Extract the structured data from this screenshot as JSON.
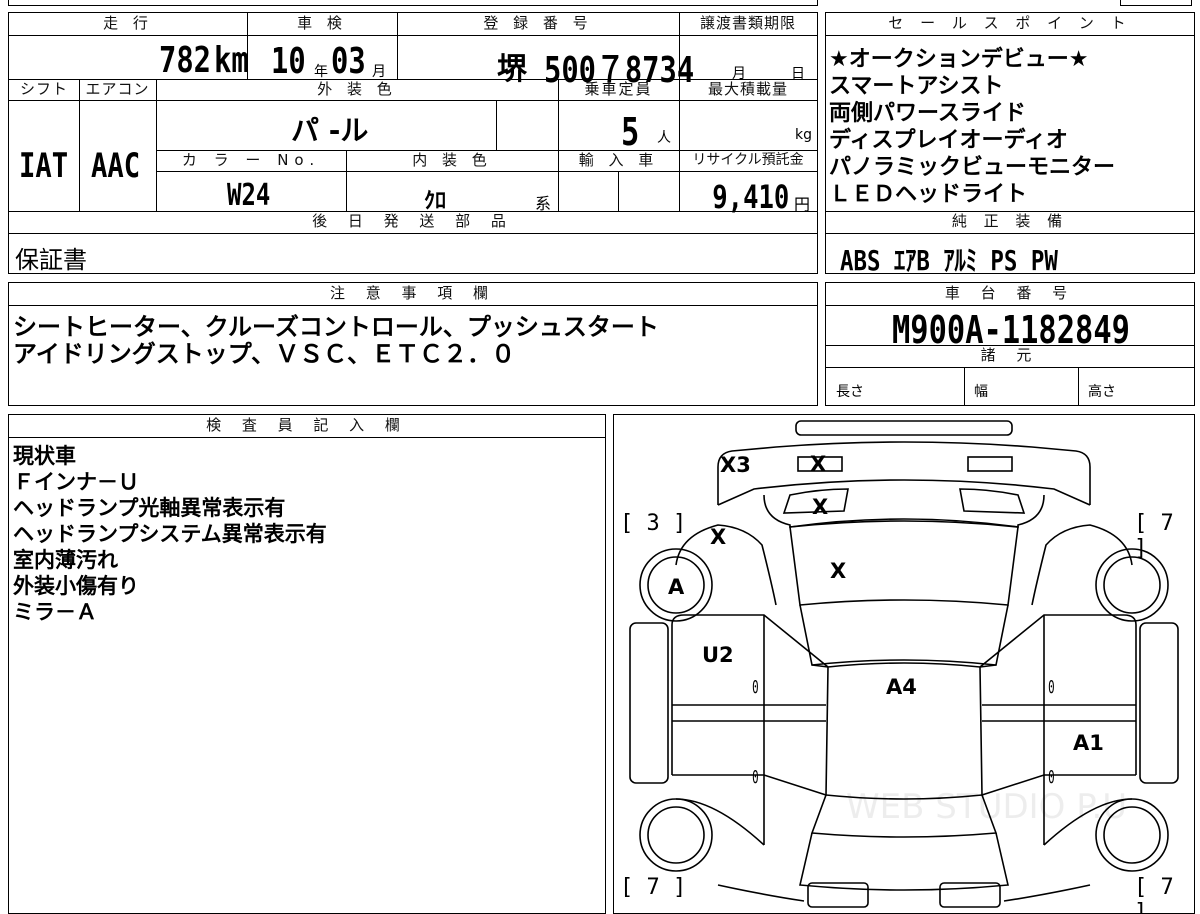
{
  "vehicle": {
    "mileage_label": "走 行",
    "mileage_value": "782",
    "mileage_unit": "km",
    "inspection_label": "車 検",
    "inspection_year": "10",
    "year_unit": "年",
    "inspection_month": "03",
    "month_unit": "月",
    "registration_label": "登 録 番 号",
    "registration_area": "堺",
    "registration_number": "500７8734",
    "transfer_deadline_label": "譲渡書類期限",
    "transfer_month_unit": "月",
    "transfer_day_unit": "日",
    "shift_label": "シフト",
    "shift_value": "IAT",
    "aircon_label": "エアコン",
    "aircon_value": "AAC",
    "exterior_color_label": "外 装 色",
    "exterior_color_value": "パ -ル",
    "capacity_label": "乗車定員",
    "capacity_value": "5",
    "capacity_unit": "人",
    "max_load_label": "最大積載量",
    "max_load_unit": "kg",
    "color_no_label": "カ ラ ー No.",
    "color_no_value": "W24",
    "interior_color_label": "内 装 色",
    "interior_color_value": "ｸﾛ",
    "interior_color_suffix": "系",
    "import_label": "輸 入 車",
    "recycle_label": "リサイクル預託金",
    "recycle_value": "9,410",
    "recycle_unit": "円"
  },
  "later_shipping": {
    "label": "後 日 発 送 部 品",
    "value": "保証書"
  },
  "notes": {
    "label": "注 意 事 項 欄",
    "lines": [
      "シートヒーター、クルーズコントロール、プッシュスタート",
      "アイドリングストップ、ＶＳＣ、ＥＴＣ２．０"
    ]
  },
  "sales_points": {
    "label": "セ ー ル ス ポ イ ン ト",
    "items": [
      "★オークションデビュー★",
      "スマートアシスト",
      "両側パワースライド",
      "ディスプレイオーディオ",
      "パノラミックビューモニター",
      "ＬＥＤヘッドライト"
    ]
  },
  "genuine_equipment": {
    "label": "純 正 装 備",
    "value": "ABS ｴｱB ｱﾙﾐ PS PW"
  },
  "chassis": {
    "label": "車 台 番 号",
    "value": "M900A-1182849"
  },
  "specs": {
    "label": "諸 元",
    "length_label": "長さ",
    "width_label": "幅",
    "height_label": "高さ"
  },
  "inspector": {
    "label": "検 査 員 記 入 欄",
    "lines": [
      "現状車",
      "Ｆインナ－Ｕ",
      "ヘッドランプ光軸異常表示有",
      "ヘッドランプシステム異常表示有",
      "室内薄汚れ",
      "外装小傷有り",
      "ミラ－Ａ"
    ]
  },
  "diagram": {
    "marks": {
      "front_x3": "X3",
      "grille_x": "X",
      "hood_top_x": "X",
      "fender_x": "X",
      "windshield_x": "X",
      "left_front_tire": "A",
      "left_front_door": "U2",
      "roof": "A4",
      "right_rear_door": "A1",
      "zero_lf": "0",
      "zero_rf": "0",
      "zero_lr": "0",
      "zero_rr": "0"
    },
    "tire_tread": {
      "front_left": "3",
      "front_right": "7",
      "rear_left": "7",
      "rear_right": "7"
    },
    "watermark": "WEB STUDIO P.U"
  }
}
